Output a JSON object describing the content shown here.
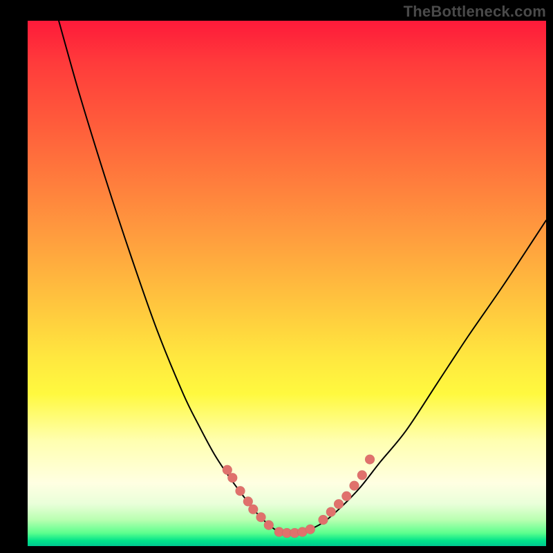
{
  "watermark": "TheBottleneck.com",
  "colors": {
    "background": "#000000",
    "gradient_top": "#fe1a3a",
    "gradient_mid": "#ffe73f",
    "gradient_bottom": "#00c890",
    "curve": "#000000",
    "dot": "#e0716c"
  },
  "chart_data": {
    "type": "line",
    "title": "",
    "xlabel": "",
    "ylabel": "",
    "xlim": [
      0,
      100
    ],
    "ylim": [
      0,
      100
    ],
    "series": [
      {
        "name": "curve",
        "x": [
          6,
          10,
          15,
          20,
          25,
          30,
          33,
          36,
          39,
          42,
          44,
          46,
          48,
          50,
          52,
          54,
          57,
          60,
          64,
          68,
          73,
          79,
          85,
          92,
          100
        ],
        "y": [
          100,
          86,
          70,
          55,
          41,
          29,
          23,
          17.5,
          13,
          9,
          6.5,
          4.5,
          3,
          2.5,
          2.5,
          3,
          4.5,
          7,
          11,
          16,
          22,
          31,
          40,
          50,
          62
        ]
      }
    ],
    "left_branch_dots": [
      {
        "x": 38.5,
        "y": 14.5
      },
      {
        "x": 39.5,
        "y": 13
      },
      {
        "x": 41,
        "y": 10.5
      },
      {
        "x": 42.5,
        "y": 8.5
      },
      {
        "x": 43.5,
        "y": 7
      },
      {
        "x": 45,
        "y": 5.5
      },
      {
        "x": 46.5,
        "y": 4
      }
    ],
    "bottom_dots": [
      {
        "x": 48.5,
        "y": 2.7
      },
      {
        "x": 50,
        "y": 2.5
      },
      {
        "x": 51.5,
        "y": 2.5
      },
      {
        "x": 53,
        "y": 2.7
      },
      {
        "x": 54.5,
        "y": 3.2
      }
    ],
    "right_branch_dots": [
      {
        "x": 57,
        "y": 5
      },
      {
        "x": 58.5,
        "y": 6.5
      },
      {
        "x": 60,
        "y": 8
      },
      {
        "x": 61.5,
        "y": 9.5
      },
      {
        "x": 63,
        "y": 11.5
      },
      {
        "x": 64.5,
        "y": 13.5
      },
      {
        "x": 66,
        "y": 16.5
      }
    ]
  }
}
